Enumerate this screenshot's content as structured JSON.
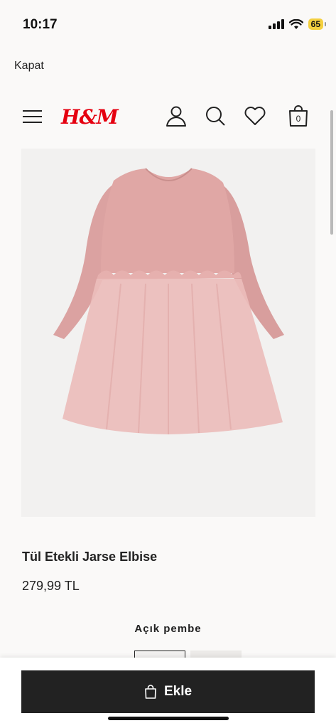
{
  "status_bar": {
    "time": "10:17",
    "battery": "65",
    "icons": [
      "signal-icon",
      "wifi-icon",
      "battery-icon"
    ]
  },
  "close_label": "Kapat",
  "header": {
    "logo": "H&M",
    "icons": [
      "menu-icon",
      "account-icon",
      "search-icon",
      "favorites-icon",
      "bag-icon"
    ],
    "bag_count": "0"
  },
  "product": {
    "title": "Tül Etekli Jarse Elbise",
    "price": "279,99 TL",
    "color_name": "Açık pembe"
  },
  "add_button": {
    "label": "Ekle",
    "icon": "bag-icon"
  },
  "colors": {
    "brand_red": "#e50010",
    "button_bg": "#222222",
    "dress_pink": "#e2a8a6"
  }
}
